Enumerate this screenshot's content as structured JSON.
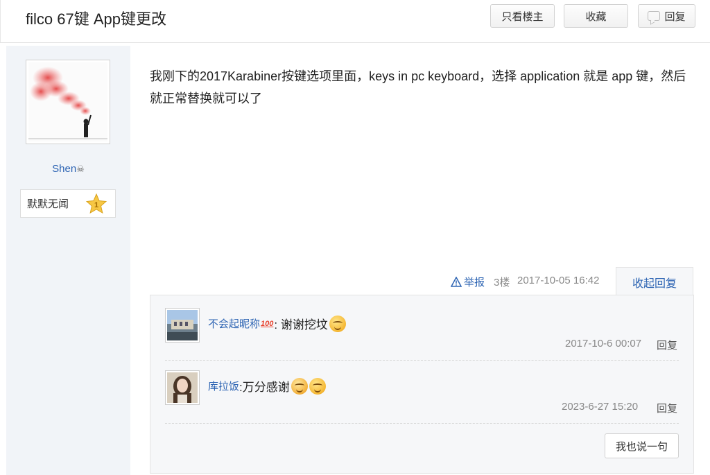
{
  "header": {
    "title": "filco 67键 App键更改",
    "btn_only_op": "只看楼主",
    "btn_favorite": "收藏",
    "btn_reply": "回复"
  },
  "author": {
    "name": "Shen",
    "rank": "默默无闻",
    "level": "1"
  },
  "post": {
    "text": "我刚下的2017Karabiner按键选项里面，keys in pc keyboard，选择 application 就是 app 键，然后就正常替换就可以了",
    "report": "举报",
    "floor": "3楼",
    "time": "2017-10-05 16:42",
    "collapse": "收起回复"
  },
  "replies": [
    {
      "name": "不会起昵称",
      "badge": "100",
      "text": ": 谢谢挖坟",
      "time": "2017-10-6 00:07",
      "reply": "回复"
    },
    {
      "name": "库拉饭",
      "text": " :万分感谢",
      "time": "2023-6-27 15:20",
      "reply": "回复"
    }
  ],
  "say_button": "我也说一句",
  "colors": {
    "link": "#2d64b3",
    "sidebar_bg": "#f1f4f8",
    "subbox_bg": "#f6f7f9"
  }
}
